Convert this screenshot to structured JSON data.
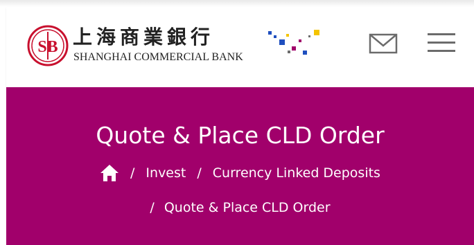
{
  "header": {
    "logo_cn": "上海商業銀行",
    "logo_en": "SHANGHAI COMMERCIAL BANK",
    "logo_monogram": "SB",
    "mail_icon": "mail-icon",
    "menu_icon": "hamburger-menu-icon"
  },
  "banner": {
    "title": "Quote & Place CLD Order",
    "breadcrumb": {
      "separator": "/",
      "home_icon": "home-icon",
      "items": [
        "Invest",
        "Currency Linked Deposits",
        "Quote & Place CLD Order"
      ]
    }
  },
  "colors": {
    "banner_bg": "#a1006b",
    "logo_red": "#c8102e",
    "text_dark": "#222222",
    "pixel_blue": "#1f4fbf",
    "pixel_yellow": "#f4c400",
    "pixel_magenta": "#a1006b"
  }
}
